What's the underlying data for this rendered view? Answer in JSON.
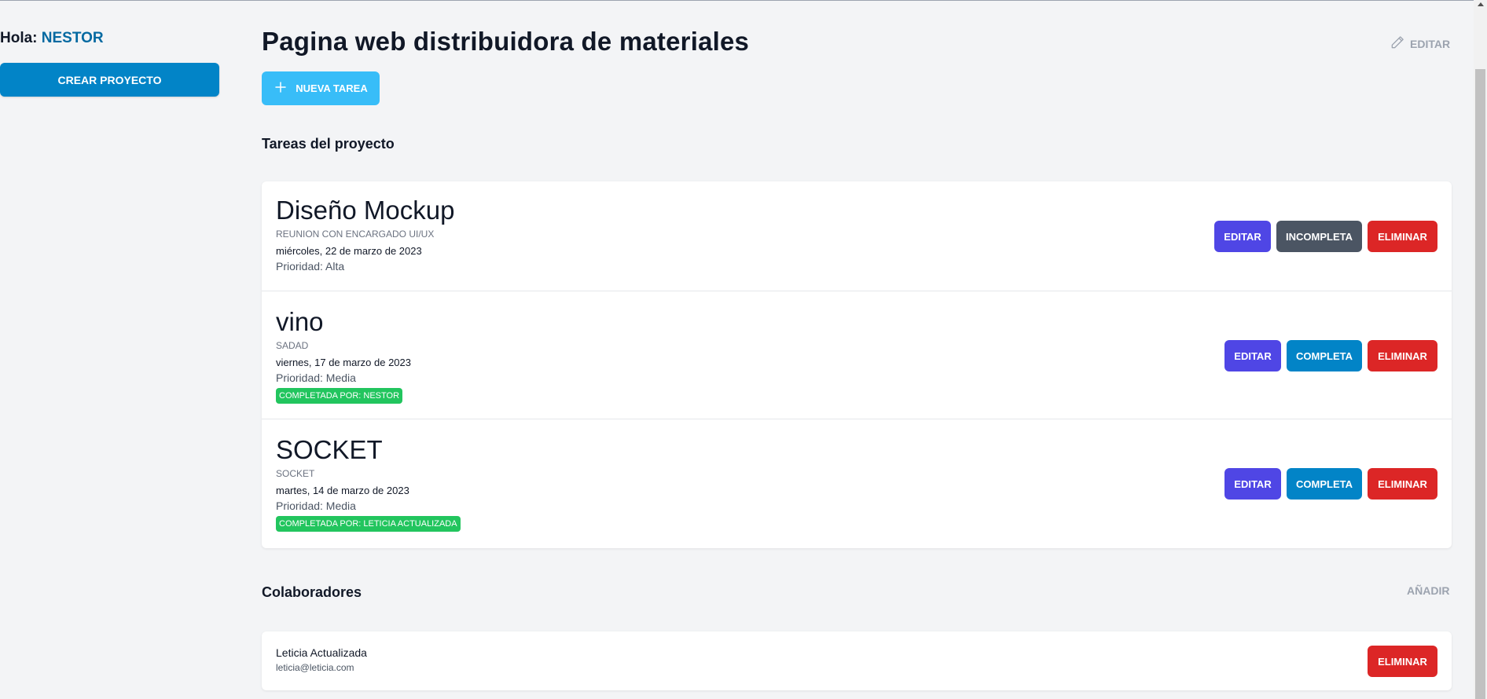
{
  "sidebar": {
    "greeting_prefix": "Hola: ",
    "user_name": "NESTOR",
    "create_project_label": "CREAR PROYECTO"
  },
  "project": {
    "title": "Pagina web distribuidora de materiales",
    "edit_label": "EDITAR",
    "new_task_label": "NUEVA TAREA"
  },
  "tasks_section": {
    "title": "Tareas del proyecto",
    "tasks": [
      {
        "name": "Diseño Mockup",
        "description": "REUNION CON ENCARGADO UI/UX",
        "date": "miércoles, 22 de marzo de 2023",
        "priority": "Prioridad: Alta",
        "completed_by": "",
        "edit_label": "EDITAR",
        "status_label": "INCOMPLETA",
        "delete_label": "ELIMINAR"
      },
      {
        "name": "vino",
        "description": "SADAD",
        "date": "viernes, 17 de marzo de 2023",
        "priority": "Prioridad: Media",
        "completed_by": "COMPLETADA POR: NESTOR",
        "edit_label": "EDITAR",
        "status_label": "COMPLETA",
        "delete_label": "ELIMINAR"
      },
      {
        "name": "SOCKET",
        "description": "SOCKET",
        "date": "martes, 14 de marzo de 2023",
        "priority": "Prioridad: Media",
        "completed_by": "COMPLETADA POR: LETICIA ACTUALIZADA",
        "edit_label": "EDITAR",
        "status_label": "COMPLETA",
        "delete_label": "ELIMINAR"
      }
    ]
  },
  "collaborators_section": {
    "title": "Colaboradores",
    "add_label": "AÑADIR",
    "collaborators": [
      {
        "name": "Leticia Actualizada",
        "email": "leticia@leticia.com",
        "delete_label": "ELIMINAR"
      }
    ]
  },
  "colors": {
    "accent": "#0284c7",
    "new_task": "#38bdf8",
    "edit": "#4f46e5",
    "incomplete": "#4b5563",
    "delete": "#dc2626",
    "completed_badge": "#22c55e"
  }
}
